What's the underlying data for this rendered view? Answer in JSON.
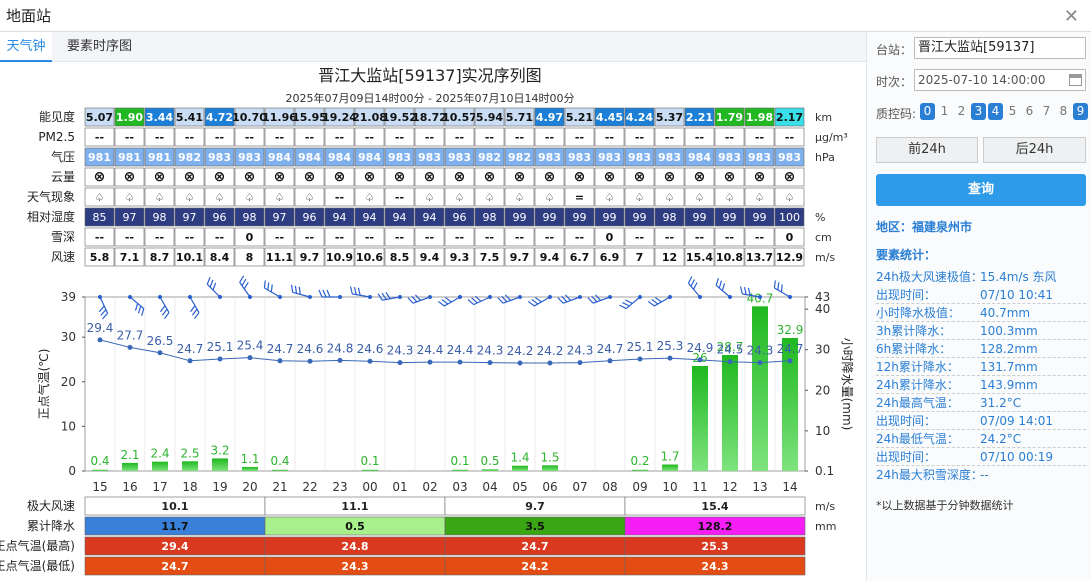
{
  "window": {
    "title": "地面站"
  },
  "tabs": [
    {
      "label": "天气钟"
    },
    {
      "label": "要素时序图"
    }
  ],
  "chart_title": "晋江大监站[59137]实况序列图",
  "chart_subtitle": "2025年07月09日14时00分 - 2025年07月10日14时00分",
  "table": {
    "rows": [
      {
        "label": "能见度",
        "unit": "km",
        "values": [
          "5.07",
          "1.90",
          "3.44",
          "5.41",
          "4.72",
          "10.70",
          "11.96",
          "15.95",
          "19.24",
          "21.08",
          "19.52",
          "18.72",
          "10.57",
          "5.94",
          "5.71",
          "4.97",
          "5.21",
          "4.45",
          "4.24",
          "5.37",
          "2.21",
          "1.79",
          "1.98",
          "2.17"
        ]
      },
      {
        "label": "PM2.5",
        "unit": "μg/m³",
        "values": [
          "--",
          "--",
          "--",
          "--",
          "--",
          "--",
          "--",
          "--",
          "--",
          "--",
          "--",
          "--",
          "--",
          "--",
          "--",
          "--",
          "--",
          "--",
          "--",
          "--",
          "--",
          "--",
          "--",
          "--"
        ]
      },
      {
        "label": "气压",
        "unit": "hPa",
        "values": [
          "981",
          "981",
          "981",
          "982",
          "983",
          "983",
          "984",
          "984",
          "984",
          "984",
          "983",
          "983",
          "983",
          "982",
          "982",
          "983",
          "983",
          "983",
          "983",
          "983",
          "984",
          "983",
          "983",
          "983"
        ]
      },
      {
        "label": "云量",
        "unit": "",
        "values": [
          "⊗",
          "⊗",
          "⊗",
          "⊗",
          "⊗",
          "⊗",
          "⊗",
          "⊗",
          "⊗",
          "⊗",
          "⊗",
          "⊗",
          "⊗",
          "⊗",
          "⊗",
          "⊗",
          "⊗",
          "⊗",
          "⊗",
          "⊗",
          "⊗",
          "⊗",
          "⊗",
          "⊗"
        ]
      },
      {
        "label": "天气现象",
        "unit": "",
        "values": [
          "♤",
          "♤",
          "♤",
          "♤",
          "♤",
          "♤",
          "♤",
          "♤",
          "--",
          "♤",
          "--",
          "♤",
          "♤",
          "♤",
          "♤",
          "♤",
          "=",
          "♤",
          "♤",
          "♤",
          "♤",
          "♤",
          "♤",
          "♤"
        ]
      },
      {
        "label": "相对湿度",
        "unit": "%",
        "values": [
          "85",
          "97",
          "98",
          "97",
          "96",
          "98",
          "97",
          "96",
          "94",
          "94",
          "94",
          "94",
          "96",
          "98",
          "99",
          "99",
          "99",
          "99",
          "99",
          "98",
          "99",
          "99",
          "99",
          "100"
        ]
      },
      {
        "label": "雪深",
        "unit": "cm",
        "values": [
          "--",
          "--",
          "--",
          "--",
          "--",
          "0",
          "--",
          "--",
          "--",
          "--",
          "--",
          "--",
          "--",
          "--",
          "--",
          "--",
          "--",
          "0",
          "--",
          "--",
          "--",
          "--",
          "--",
          "0"
        ]
      },
      {
        "label": "风速",
        "unit": "m/s",
        "values": [
          "5.8",
          "7.1",
          "8.7",
          "10.1",
          "8.4",
          "8",
          "11.1",
          "9.7",
          "10.9",
          "10.6",
          "8.5",
          "9.4",
          "9.3",
          "7.5",
          "9.7",
          "9.4",
          "6.7",
          "6.9",
          "7",
          "12",
          "15.4",
          "10.8",
          "13.7",
          "12.9"
        ]
      }
    ],
    "colors": {
      "vis_green": "#22b822",
      "vis_blue": "#1c80d8",
      "vis_cyan": "#39dfe8",
      "vis_default": "#c9ddf5",
      "pressure": "#7fb1ee",
      "humidity": "#2e3c82"
    }
  },
  "chart_data": {
    "type": "line",
    "x": [
      "15",
      "16",
      "17",
      "18",
      "19",
      "20",
      "21",
      "22",
      "23",
      "00",
      "01",
      "02",
      "03",
      "04",
      "05",
      "06",
      "07",
      "08",
      "09",
      "10",
      "11",
      "12",
      "13",
      "14"
    ],
    "series": [
      {
        "name": "正点气温(℃)",
        "values": [
          29.4,
          27.7,
          26.5,
          24.7,
          25.1,
          25.4,
          24.7,
          24.6,
          24.8,
          24.6,
          24.3,
          24.4,
          24.4,
          24.3,
          24.2,
          24.2,
          24.3,
          24.7,
          25.1,
          25.3,
          24.9,
          24.5,
          24.3,
          24.7
        ],
        "labels": [
          "29.4",
          "27.7",
          "26.5",
          "24.7",
          "25.1",
          "25.4",
          "24.7",
          "24.6",
          "24.8",
          "24.6",
          "24.3",
          "24.4",
          "24.4",
          "24.3",
          "24.2",
          "24.2",
          "24.3",
          "24.7",
          "25.1",
          "25.3",
          "24.9",
          "24.5",
          "24.3",
          "24.7"
        ],
        "color": "#3a68b8"
      },
      {
        "name": "小时降水量(mm)",
        "type": "bar",
        "values": [
          0.4,
          2.1,
          2.4,
          2.5,
          3.2,
          1.1,
          0.4,
          0,
          0,
          0.1,
          0,
          0,
          0.1,
          0.5,
          1.4,
          1.5,
          0,
          0,
          0.2,
          1.7,
          26,
          28.7,
          40.7,
          32.9
        ],
        "labels": [
          "0.4",
          "2.1",
          "2.4",
          "2.5",
          "3.2",
          "1.1",
          "0.4",
          "",
          "",
          "0.1",
          "",
          "",
          "0.1",
          "0.5",
          "1.4",
          "1.5",
          "",
          "",
          "0.2",
          "1.7",
          "26",
          "28.7",
          "40.7",
          "32.9"
        ],
        "color": "#2fc42f"
      }
    ],
    "ylabel_left": "正点气温(℃)",
    "ylabel_right": "小时降水量(mm)",
    "yticks_left": [
      "39",
      "30",
      "20",
      "10",
      "0"
    ],
    "ylim_left": [
      0,
      39
    ],
    "yticks_right": [
      "43",
      "40",
      "30",
      "20",
      "10",
      "0.1"
    ],
    "ylim_right": [
      0.1,
      43
    ],
    "wind_dirs_deg": [
      155,
      130,
      150,
      150,
      315,
      325,
      300,
      285,
      270,
      280,
      260,
      250,
      240,
      245,
      250,
      240,
      250,
      250,
      230,
      240,
      320,
      310,
      280,
      300
    ],
    "grid": true
  },
  "summary": {
    "units": [
      "m/s",
      "mm"
    ],
    "rows": [
      {
        "label": "极大风速",
        "values": [
          "10.1",
          "11.1",
          "9.7",
          "15.4"
        ],
        "colors": [
          "#ffffff",
          "#ffffff",
          "#ffffff",
          "#ffffff"
        ],
        "text": "#222222"
      },
      {
        "label": "累计降水",
        "values": [
          "11.7",
          "0.5",
          "3.5",
          "128.2"
        ],
        "colors": [
          "#3a7fd8",
          "#a8f08c",
          "#3aa614",
          "#f51ff5"
        ],
        "text": "#111111"
      },
      {
        "label": "正点气温(最高)",
        "values": [
          "29.4",
          "24.8",
          "24.7",
          "25.3"
        ],
        "colors": [
          "#d93a1f",
          "#d93a1f",
          "#d93a1f",
          "#d93a1f"
        ],
        "text": "#ffffff"
      },
      {
        "label": "正点气温(最低)",
        "values": [
          "24.7",
          "24.3",
          "24.2",
          "24.3"
        ],
        "colors": [
          "#e34c12",
          "#e34c12",
          "#e34c12",
          "#e34c12"
        ],
        "text": "#ffffff"
      }
    ]
  },
  "right": {
    "station_label": "台站：",
    "station_value": "晋江大监站[59137]",
    "time_label": "时次：",
    "time_value": "2025-07-10 14:00:00",
    "qc_label": "质控码:",
    "qc": [
      "0",
      "1",
      "2",
      "3",
      "4",
      "5",
      "6",
      "7",
      "8",
      "9"
    ],
    "qc_on": [
      0,
      3,
      4,
      9
    ],
    "prev_label": "前24h",
    "next_label": "后24h",
    "query_label": "查询",
    "region": "地区：福建泉州市",
    "stats_title": "要素统计：",
    "stats": [
      {
        "k": "24h极大风速极值：",
        "v": "15.4m/s 东风"
      },
      {
        "k": "出现时间：",
        "v": "07/10 10:41"
      },
      {
        "k": "小时降水极值：",
        "v": "40.7mm"
      },
      {
        "k": "3h累计降水：",
        "v": "100.3mm"
      },
      {
        "k": "6h累计降水：",
        "v": "128.2mm"
      },
      {
        "k": "12h累计降水：",
        "v": "131.7mm"
      },
      {
        "k": "24h累计降水：",
        "v": "143.9mm"
      },
      {
        "k": "24h最高气温：",
        "v": "31.2°C"
      },
      {
        "k": "出现时间：",
        "v": "07/09 14:01"
      },
      {
        "k": "24h最低气温：",
        "v": "24.2°C"
      },
      {
        "k": "出现时间：",
        "v": "07/10 00:19"
      },
      {
        "k": "24h最大积雪深度：",
        "v": "--"
      }
    ],
    "note": "*以上数据基于分钟数据统计"
  }
}
